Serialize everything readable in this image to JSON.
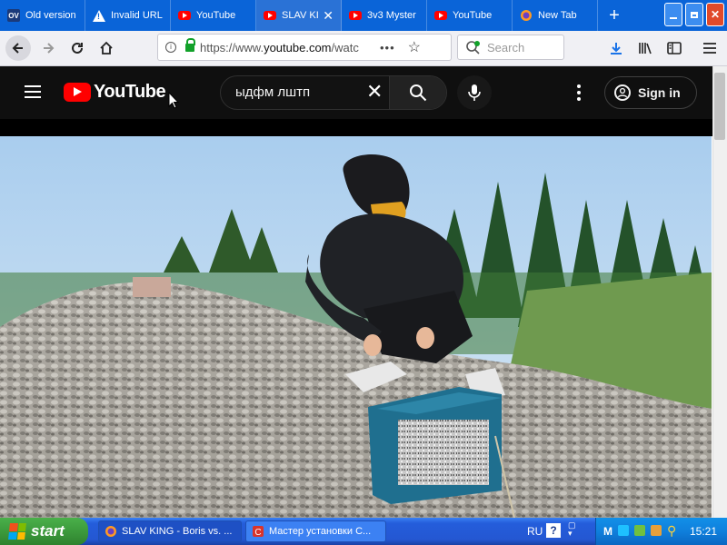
{
  "browser": {
    "tabs": [
      {
        "title": "Old version",
        "icon": "ov-favicon",
        "icon_text": "OV"
      },
      {
        "title": "Invalid URL",
        "icon": "warning-icon"
      },
      {
        "title": "YouTube",
        "icon": "youtube-favicon"
      },
      {
        "title": "SLAV KI",
        "icon": "youtube-favicon",
        "active": true
      },
      {
        "title": "3v3 Myster",
        "icon": "youtube-favicon"
      },
      {
        "title": "YouTube",
        "icon": "youtube-favicon"
      },
      {
        "title": "New Tab",
        "icon": "firefox-favicon"
      }
    ],
    "new_tab_symbol": "+",
    "close_symbol": "✕",
    "url_prefix": "https://www.",
    "url_host": "youtube.com",
    "url_rest": "/watc",
    "page_actions": "•••",
    "search_placeholder": "Search"
  },
  "youtube": {
    "logo_text": "YouTube",
    "search_query": "ыдфм лштп",
    "clear_symbol": "✕",
    "sign_in_label": "Sign in"
  },
  "taskbar": {
    "start_label": "start",
    "tasks": [
      {
        "label": "SLAV KING - Boris vs. ...",
        "icon": "firefox-icon"
      },
      {
        "label": "Мастер установки С...",
        "icon": "installer-icon"
      }
    ],
    "language": "RU",
    "help_symbol": "?",
    "clock": "15:21"
  },
  "colors": {
    "tabstrip": "#0a64d8",
    "youtube_red": "#ff0000",
    "youtube_bg": "#0f0f0f",
    "taskbar_blue": "#245ddb",
    "start_green": "#3c9a3c",
    "tray_blue": "#0f7fdc"
  }
}
